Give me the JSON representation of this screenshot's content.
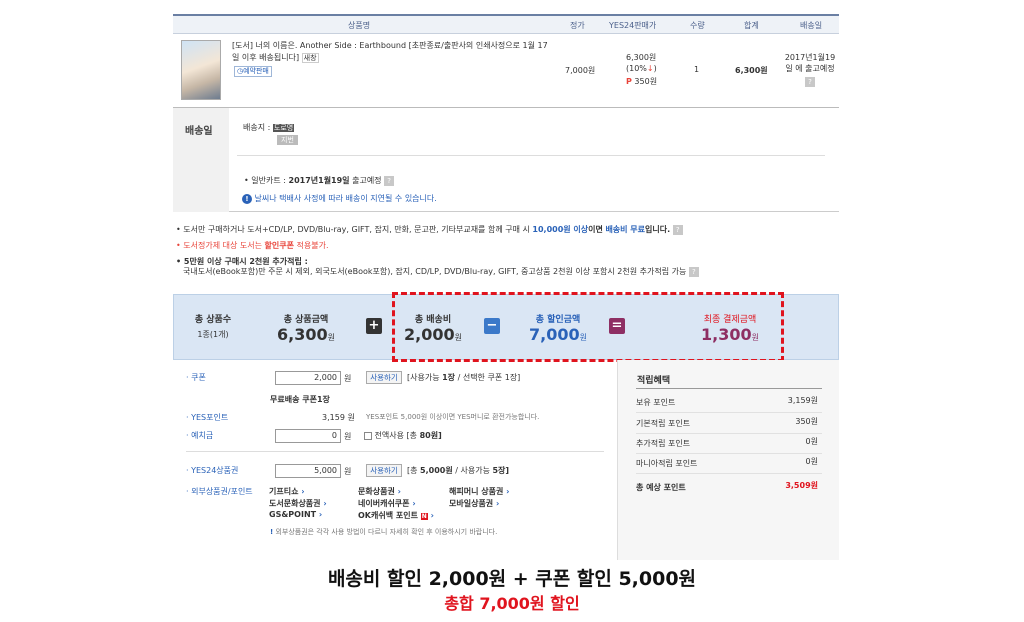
{
  "table": {
    "headers": [
      "상품명",
      "정가",
      "YES24판매가",
      "수량",
      "합계",
      "배송일"
    ],
    "item": {
      "title": "[도서] 너의 이름은. Another Side : Earthbound [초판종료/출판사의 인쇄사정으로 1월 17일 이후 배송됩니다]",
      "badge": "새창",
      "tag": "예약판매",
      "list_price": "7,000원",
      "sale_price": "6,300원",
      "discount": "(10%",
      "points": "350원",
      "qty": "1",
      "total": "6,300원",
      "delivery": "2017년1월19일 에 출고예정"
    }
  },
  "shipping": {
    "label": "배송일",
    "dest_label": "배송지 :",
    "dest_tag": "도로명",
    "dest_sub": "지번",
    "general_cart": "일반카트 :",
    "general_date": "2017년1월19일",
    "general_suffix": "출고예정",
    "weather_notice": "날씨나 택배사 사정에 따라 배송이 지연될 수 있습니다."
  },
  "notices": {
    "n1_pre": "도서만 구매하거나 도서+CD/LP, DVD/Blu-ray, GIFT, 잡지, 만화, 문고판, 기타부교재를 함께 구매 시",
    "n1_amount": "10,000원 이상",
    "n1_mid": "이면",
    "n1_free": "배송비 무료",
    "n1_end": "입니다.",
    "n2_pre": "도서정가제 대상 도서는",
    "n2_coupon": "할인쿠폰",
    "n2_end": "적용불가.",
    "n3_title": "5만원 이상 구매시 2천원 추가적립 :",
    "n3_body": "국내도서(eBook포함)만 주문 시 제외, 외국도서(eBook포함), 잡지, CD/LP, DVD/Blu-ray, GIFT, 중고상품 2천원 이상 포함시 2천원 추가적립 가능"
  },
  "summary": {
    "count_label": "총 상품수",
    "count_value": "1종(1개)",
    "goods_label": "총 상품금액",
    "goods_value": "6,300",
    "ship_label": "총 배송비",
    "ship_value": "2,000",
    "disc_label": "총 할인금액",
    "disc_value": "7,000",
    "final_label": "최종 결제금액",
    "final_value": "1,300",
    "won": "원",
    "plus": "+",
    "minus": "−",
    "equals": "="
  },
  "payment": {
    "coupon_label": "쿠폰",
    "coupon_value": "2,000",
    "won": "원",
    "use_btn": "사용하기",
    "coupon_info_pre": "[사용가능",
    "coupon_info_n1": "1장",
    "coupon_info_mid": "/ 선택한 쿠폰",
    "coupon_info_n2": "1장]",
    "free_ship_coupon": "무료배송 쿠폰1장",
    "yes_point_label": "YES포인트",
    "yes_point_value": "3,159 원",
    "yes_point_note": "YES포인트 5,000원 이상이면 YES머니로 환전가능합니다.",
    "deposit_label": "예치금",
    "deposit_value": "0",
    "deposit_all": "전액사용",
    "deposit_total": "[총",
    "deposit_amount": "80원]",
    "giftcard_label": "YES24상품권",
    "giftcard_value": "5,000",
    "giftcard_info_pre": "[총",
    "giftcard_info_amt": "5,000원",
    "giftcard_info_mid": "/ 사용가능",
    "giftcard_info_n": "5장]",
    "external_label": "외부상품권/포인트",
    "external_items": [
      "기프티쇼",
      "문화상품권",
      "해피머니 상품권",
      "도서문화상품권",
      "네이버캐쉬쿠폰",
      "모바일상품권",
      "GS&POINT",
      "OK캐쉬백 포인트"
    ],
    "external_note": "외부상품권은 각각 사용 방법이 다르니 자세히 확인 후 이용하시기 바랍니다."
  },
  "points": {
    "title": "적립혜택",
    "rows": [
      {
        "label": "보유 포인트",
        "value": "3,159원"
      },
      {
        "label": "기본적립 포인트",
        "value": "350원"
      },
      {
        "label": "추가적립 포인트",
        "value": "0원"
      },
      {
        "label": "마니아적립 포인트",
        "value": "0원"
      }
    ],
    "total_label": "총 예상 포인트",
    "total_value": "3,509원"
  },
  "caption": {
    "line1": "배송비 할인 2,000원 + 쿠폰 할인 5,000원",
    "line2": "총합 7,000원 할인"
  },
  "colors": {
    "accent_blue": "#2a62b8",
    "accent_red": "#e0141e",
    "summary_bg": "#dae6f4",
    "final_purple": "#8e2f63"
  }
}
